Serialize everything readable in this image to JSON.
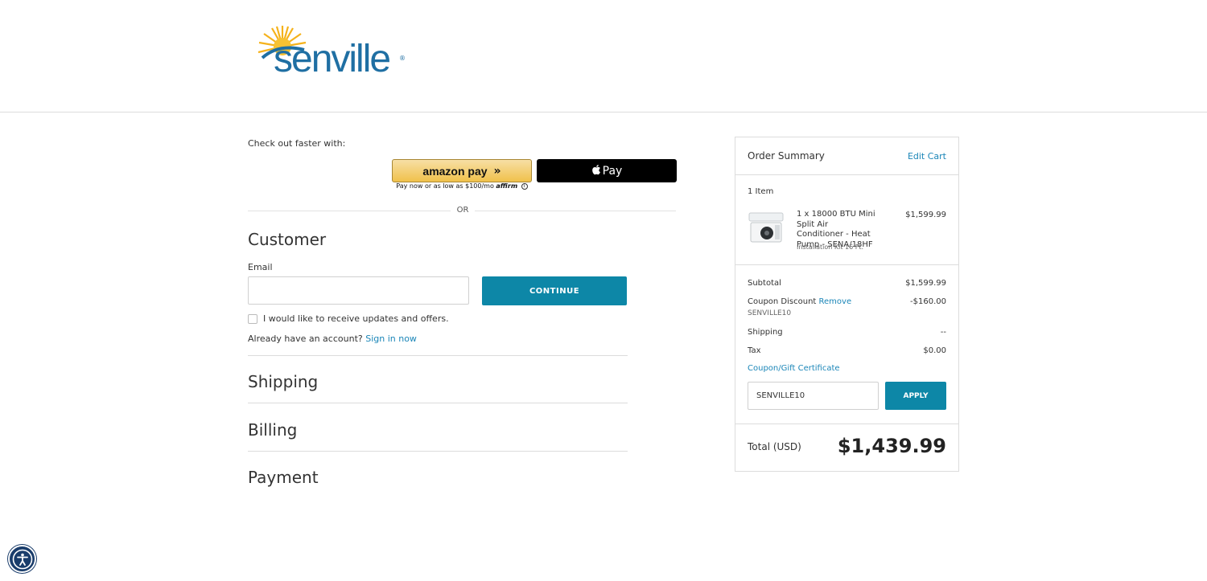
{
  "header": {
    "logo_text": "senville",
    "logo_mark": "®"
  },
  "checkout": {
    "fast_label": "Check out faster with:",
    "amazon_pay_label": "amazon pay",
    "amazon_pay_arrows": "»",
    "affirm_text": "Pay now or as low as $100/mo",
    "affirm_brand": "affirm",
    "apple_pay_label": "Pay",
    "or_label": "OR"
  },
  "customer": {
    "title": "Customer",
    "email_label": "Email",
    "email_value": "",
    "continue_label": "CONTINUE",
    "updates_label": "I would like to receive updates and offers.",
    "account_prompt": "Already have an account?",
    "sign_in_label": "Sign in now"
  },
  "steps": {
    "shipping": "Shipping",
    "billing": "Billing",
    "payment": "Payment"
  },
  "summary": {
    "title": "Order Summary",
    "edit_cart": "Edit Cart",
    "item_count": "1 Item",
    "product_name": "1 x 18000 BTU Mini Split Air Conditioner - Heat Pump - SENA/18HF",
    "product_option": "Installation Kit 16 Ft.",
    "product_price": "$1,599.99",
    "subtotal_label": "Subtotal",
    "subtotal_value": "$1,599.99",
    "coupon_label": "Coupon Discount",
    "coupon_remove": "Remove",
    "coupon_code": "SENVILLE10",
    "coupon_value": "-$160.00",
    "shipping_label": "Shipping",
    "shipping_value": "--",
    "tax_label": "Tax",
    "tax_value": "$0.00",
    "gift_link": "Coupon/Gift Certificate",
    "coupon_input_value": "SENVILLE10",
    "apply_label": "APPLY",
    "total_label": "Total (USD)",
    "total_value": "$1,439.99"
  },
  "colors": {
    "accent": "#0d87a7",
    "link": "#1b86b8",
    "brand_blue": "#1f6fa3",
    "brand_sun": "#f5b21b"
  },
  "icons": [
    "sun-logo-icon",
    "amazon-arrows-icon",
    "info-icon",
    "apple-icon",
    "product-thumbnail",
    "accessibility-icon"
  ]
}
